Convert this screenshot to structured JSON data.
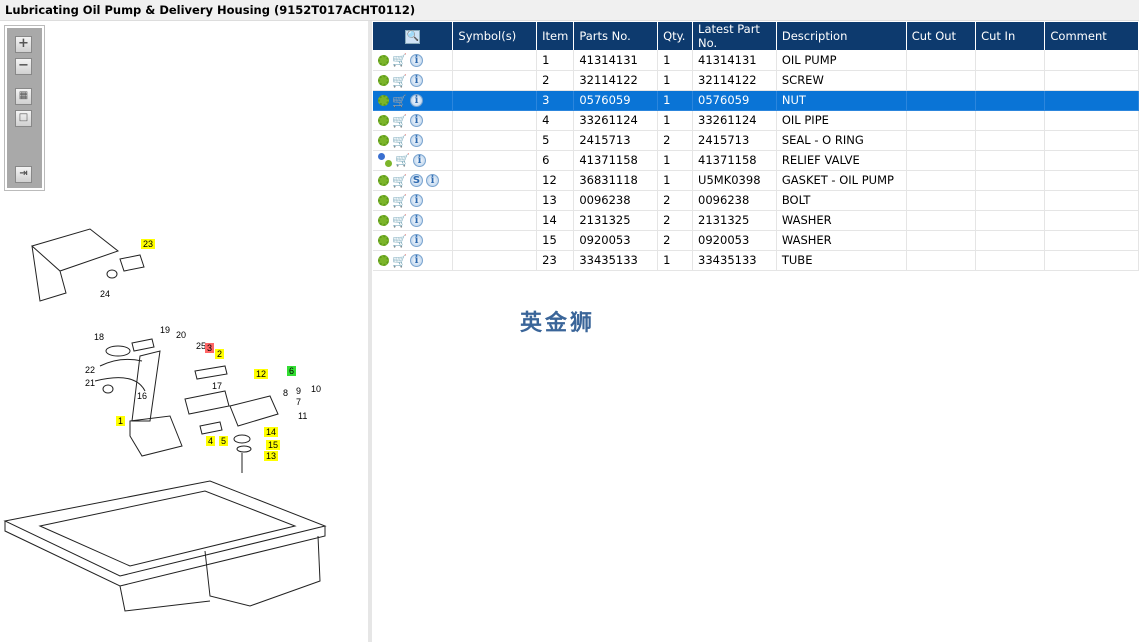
{
  "window": {
    "title": "Lubricating Oil Pump & Delivery Housing (9152T017ACHT0112)"
  },
  "toolbar": {
    "buttons": [
      "zoom-in",
      "zoom-out",
      "fit-all",
      "actual-size",
      "export"
    ]
  },
  "table": {
    "headers": [
      "",
      "Symbol(s)",
      "Item",
      "Parts No.",
      "Qty.",
      "Latest Part No.",
      "Description",
      "Cut Out",
      "Cut In",
      "Comment"
    ],
    "selected_item": "3",
    "rows": [
      {
        "icons": [
          "gear",
          "cart",
          "info"
        ],
        "symbol": "",
        "item": "1",
        "part": "41314131",
        "qty": "1",
        "latest": "41314131",
        "desc": "OIL PUMP",
        "cut_out": "",
        "cut_in": "",
        "comment": ""
      },
      {
        "icons": [
          "gear",
          "cart",
          "info"
        ],
        "symbol": "",
        "item": "2",
        "part": "32114122",
        "qty": "1",
        "latest": "32114122",
        "desc": "SCREW",
        "cut_out": "",
        "cut_in": "",
        "comment": ""
      },
      {
        "icons": [
          "gear",
          "cart",
          "info"
        ],
        "symbol": "",
        "item": "3",
        "part": "0576059",
        "qty": "1",
        "latest": "0576059",
        "desc": "NUT",
        "cut_out": "",
        "cut_in": "",
        "comment": ""
      },
      {
        "icons": [
          "gear",
          "cart",
          "info"
        ],
        "symbol": "",
        "item": "4",
        "part": "33261124",
        "qty": "1",
        "latest": "33261124",
        "desc": "OIL PIPE",
        "cut_out": "",
        "cut_in": "",
        "comment": ""
      },
      {
        "icons": [
          "gear",
          "cart",
          "info"
        ],
        "symbol": "",
        "item": "5",
        "part": "2415713",
        "qty": "2",
        "latest": "2415713",
        "desc": "SEAL - O RING",
        "cut_out": "",
        "cut_in": "",
        "comment": ""
      },
      {
        "icons": [
          "gears",
          "cart",
          "info"
        ],
        "symbol": "",
        "item": "6",
        "part": "41371158",
        "qty": "1",
        "latest": "41371158",
        "desc": "RELIEF VALVE",
        "cut_out": "",
        "cut_in": "",
        "comment": ""
      },
      {
        "icons": [
          "gear",
          "cart",
          "s",
          "info"
        ],
        "symbol": "",
        "item": "12",
        "part": "36831118",
        "qty": "1",
        "latest": "U5MK0398",
        "desc": "GASKET - OIL PUMP",
        "cut_out": "",
        "cut_in": "",
        "comment": ""
      },
      {
        "icons": [
          "gear",
          "cart",
          "info"
        ],
        "symbol": "",
        "item": "13",
        "part": "0096238",
        "qty": "2",
        "latest": "0096238",
        "desc": "BOLT",
        "cut_out": "",
        "cut_in": "",
        "comment": ""
      },
      {
        "icons": [
          "gear",
          "cart",
          "info"
        ],
        "symbol": "",
        "item": "14",
        "part": "2131325",
        "qty": "2",
        "latest": "2131325",
        "desc": "WASHER",
        "cut_out": "",
        "cut_in": "",
        "comment": ""
      },
      {
        "icons": [
          "gear",
          "cart",
          "info"
        ],
        "symbol": "",
        "item": "15",
        "part": "0920053",
        "qty": "2",
        "latest": "0920053",
        "desc": "WASHER",
        "cut_out": "",
        "cut_in": "",
        "comment": ""
      },
      {
        "icons": [
          "gear",
          "cart",
          "info"
        ],
        "symbol": "",
        "item": "23",
        "part": "33435133",
        "qty": "1",
        "latest": "33435133",
        "desc": "TUBE",
        "cut_out": "",
        "cut_in": "",
        "comment": ""
      }
    ]
  },
  "watermark": "英金狮",
  "diagram": {
    "callouts": [
      {
        "t": "23",
        "hl": "yellow"
      },
      {
        "t": "24",
        "hl": ""
      },
      {
        "t": "18",
        "hl": ""
      },
      {
        "t": "19",
        "hl": ""
      },
      {
        "t": "20",
        "hl": ""
      },
      {
        "t": "25",
        "hl": ""
      },
      {
        "t": "3",
        "hl": "red"
      },
      {
        "t": "2",
        "hl": "yellow"
      },
      {
        "t": "22",
        "hl": ""
      },
      {
        "t": "21",
        "hl": ""
      },
      {
        "t": "16",
        "hl": ""
      },
      {
        "t": "17",
        "hl": ""
      },
      {
        "t": "12",
        "hl": "yellow"
      },
      {
        "t": "6",
        "hl": "green"
      },
      {
        "t": "7",
        "hl": ""
      },
      {
        "t": "8",
        "hl": ""
      },
      {
        "t": "9",
        "hl": ""
      },
      {
        "t": "10",
        "hl": ""
      },
      {
        "t": "11",
        "hl": ""
      },
      {
        "t": "1",
        "hl": "yellow"
      },
      {
        "t": "4",
        "hl": "yellow"
      },
      {
        "t": "5",
        "hl": "yellow"
      },
      {
        "t": "14",
        "hl": "yellow"
      },
      {
        "t": "15",
        "hl": "yellow"
      },
      {
        "t": "13",
        "hl": "yellow"
      }
    ]
  },
  "colors": {
    "header": "#0d3a6e",
    "selected": "#0a74d6",
    "highlight_yellow": "#ffff00",
    "highlight_red": "#ff6666",
    "highlight_green": "#33dd33"
  }
}
